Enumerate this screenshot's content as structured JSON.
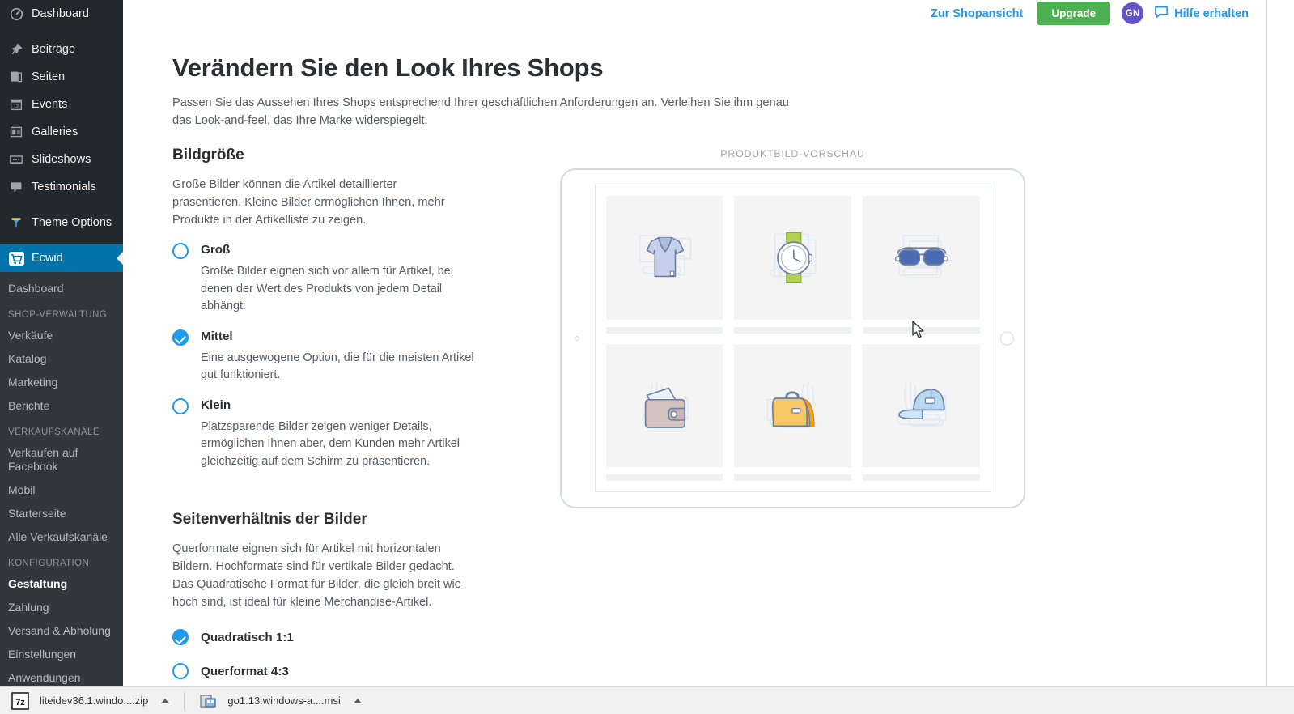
{
  "sidebar": {
    "main_items": [
      {
        "label": "Dashboard",
        "icon": "dashboard-icon"
      },
      {
        "label": "Beiträge",
        "icon": "pin-icon"
      },
      {
        "label": "Seiten",
        "icon": "pages-icon"
      },
      {
        "label": "Events",
        "icon": "calendar-icon"
      },
      {
        "label": "Galleries",
        "icon": "gallery-icon"
      },
      {
        "label": "Slideshows",
        "icon": "slideshow-icon"
      },
      {
        "label": "Testimonials",
        "icon": "testimonial-icon"
      },
      {
        "label": "Theme Options",
        "icon": "theme-options-icon"
      }
    ],
    "active_item": {
      "label": "Ecwid",
      "icon": "ecwid-cart-icon"
    },
    "submenu": [
      {
        "label": "Dashboard",
        "type": "link",
        "current": false
      },
      {
        "label": "SHOP-VERWALTUNG",
        "type": "heading"
      },
      {
        "label": "Verkäufe",
        "type": "link",
        "current": false
      },
      {
        "label": "Katalog",
        "type": "link",
        "current": false
      },
      {
        "label": "Marketing",
        "type": "link",
        "current": false
      },
      {
        "label": "Berichte",
        "type": "link",
        "current": false
      },
      {
        "label": "VERKAUFSKANÄLE",
        "type": "heading"
      },
      {
        "label": "Verkaufen auf Facebook",
        "type": "link",
        "current": false
      },
      {
        "label": "Mobil",
        "type": "link",
        "current": false
      },
      {
        "label": "Starterseite",
        "type": "link",
        "current": false
      },
      {
        "label": "Alle Verkaufskanäle",
        "type": "link",
        "current": false
      },
      {
        "label": "KONFIGURATION",
        "type": "heading"
      },
      {
        "label": "Gestaltung",
        "type": "link",
        "current": true
      },
      {
        "label": "Zahlung",
        "type": "link",
        "current": false
      },
      {
        "label": "Versand & Abholung",
        "type": "link",
        "current": false
      },
      {
        "label": "Einstellungen",
        "type": "link",
        "current": false
      },
      {
        "label": "Anwendungen",
        "type": "link",
        "current": false
      }
    ]
  },
  "topbar": {
    "shop_view_label": "Zur Shopansicht",
    "upgrade_label": "Upgrade",
    "avatar_initials": "GN",
    "help_label": "Hilfe erhalten",
    "help_icon": "chat-bubble-icon",
    "link_color": "#2196f3",
    "upgrade_color": "#4caf50",
    "avatar_color": "#6355c7"
  },
  "page": {
    "title": "Verändern Sie den Look Ihres Shops",
    "subtitle": "Passen Sie das Aussehen Ihres Shops entsprechend Ihrer geschäftlichen Anforderungen an. Verleihen Sie ihm genau das Look-and-feel, das Ihre Marke widerspiegelt."
  },
  "section_image_size": {
    "title": "Bildgröße",
    "description": "Große Bilder können die Artikel detaillierter präsentieren. Kleine Bilder ermöglichen Ihnen, mehr Produkte in der Artikelliste zu zeigen.",
    "options": [
      {
        "label": "Groß",
        "description": "Große Bilder eignen sich vor allem für Artikel, bei denen der Wert des Produkts von jedem Detail abhängt.",
        "selected": false
      },
      {
        "label": "Mittel",
        "description": "Eine ausgewogene Option, die für die meisten Artikel gut funktioniert.",
        "selected": true
      },
      {
        "label": "Klein",
        "description": "Platzsparende Bilder zeigen weniger Details, ermöglichen Ihnen aber, dem Kunden mehr Artikel gleichzeitig auf dem Schirm zu präsentieren.",
        "selected": false
      }
    ]
  },
  "section_aspect_ratio": {
    "title": "Seitenverhältnis der Bilder",
    "description": "Querformate eignen sich für Artikel mit horizontalen Bildern. Hochformate sind für vertikale Bilder gedacht. Das Quadratische Format für Bilder, die gleich breit wie hoch sind, ist ideal für kleine Merchandise-Artikel.",
    "options": [
      {
        "label": "Quadratisch 1:1",
        "selected": true
      },
      {
        "label": "Querformat 4:3",
        "selected": false
      }
    ]
  },
  "preview": {
    "caption": "Produktbild-Vorschau",
    "device": "tablet",
    "products": [
      {
        "name": "tshirt-illustration"
      },
      {
        "name": "watch-illustration"
      },
      {
        "name": "sunglasses-illustration"
      },
      {
        "name": "wallet-illustration"
      },
      {
        "name": "bag-illustration"
      },
      {
        "name": "cap-illustration"
      }
    ]
  },
  "download_bar": {
    "items": [
      {
        "name": "liteidev36.1.windo....zip",
        "icon": "7zip-archive-icon"
      },
      {
        "name": "go1.13.windows-a....msi",
        "icon": "msi-installer-icon"
      }
    ]
  },
  "colors": {
    "sidebar_bg": "#23282d",
    "submenu_bg": "#32373c",
    "accent_blue": "#0073aa",
    "radio_blue": "#1e9bf0"
  }
}
